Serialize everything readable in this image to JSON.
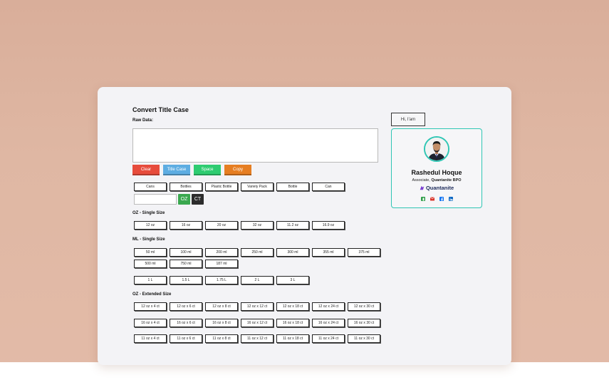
{
  "page": {
    "title": "Convert Title Case",
    "raw_label": "Raw Data:",
    "raw_value": ""
  },
  "actions": [
    {
      "label": "Clear",
      "color": "#e74c3c"
    },
    {
      "label": "Title Case",
      "color": "#5dade2"
    },
    {
      "label": "Space",
      "color": "#2ecc71"
    },
    {
      "label": "Copy",
      "color": "#e67e22"
    }
  ],
  "categories": [
    "Cans",
    "Bottles",
    "Plastic Bottle",
    "Variety Pack",
    "Bottle",
    "Can"
  ],
  "unit_input_value": "",
  "oz_button": "OZ",
  "ct_button": "CT",
  "oz_single": {
    "label": "OZ - Single Size",
    "items": [
      "12 oz",
      "16 oz",
      "20 oz",
      "32 oz",
      "11.2 oz",
      "16.9 oz"
    ]
  },
  "ml_single": {
    "label": "ML - Single Size",
    "row1": [
      "50 ml",
      "100 ml",
      "200 ml",
      "250 ml",
      "300 ml",
      "355 ml",
      "375 ml"
    ],
    "row2": [
      "500 ml",
      "750 ml",
      "187 ml"
    ],
    "row3": [
      "1 L",
      "1.5 L",
      "1.75 L",
      "2 L",
      "3 L"
    ]
  },
  "oz_extended": {
    "label": "OZ - Extended Size",
    "row1": [
      "12 oz x 4 ct",
      "12 oz x 6 ct",
      "12 oz x 8 ct",
      "12 oz x 12 ct",
      "12 oz x 18 ct",
      "12 oz x 24 ct",
      "12 oz x 30 ct"
    ],
    "row2": [
      "16 oz x 4 ct",
      "16 oz x 6 ct",
      "16 oz x 8 ct",
      "16 oz x 12 ct",
      "16 oz x 18 ct",
      "16 oz x 24 ct",
      "16 oz x 30 ct"
    ],
    "row3": [
      "11 oz x 4 ct",
      "11 oz x 6 ct",
      "11 oz x 8 ct",
      "11 oz x 12 ct",
      "11 oz x 18 ct",
      "11 oz x 24 ct",
      "11 oz x 30 ct"
    ]
  },
  "profile": {
    "greeting": "Hi, I'am",
    "name": "Rashedul Hoque",
    "role_prefix": "Associate,",
    "company": "Quantanite BPO",
    "brand": "Quantanite",
    "accent": "#2fc6b4",
    "socials": [
      {
        "icon": "phone-icon",
        "color": "#2e9e48"
      },
      {
        "icon": "mail-icon",
        "color": "#d93025"
      },
      {
        "icon": "facebook-icon",
        "color": "#1877f2"
      },
      {
        "icon": "linkedin-icon",
        "color": "#0a66c2"
      }
    ]
  }
}
